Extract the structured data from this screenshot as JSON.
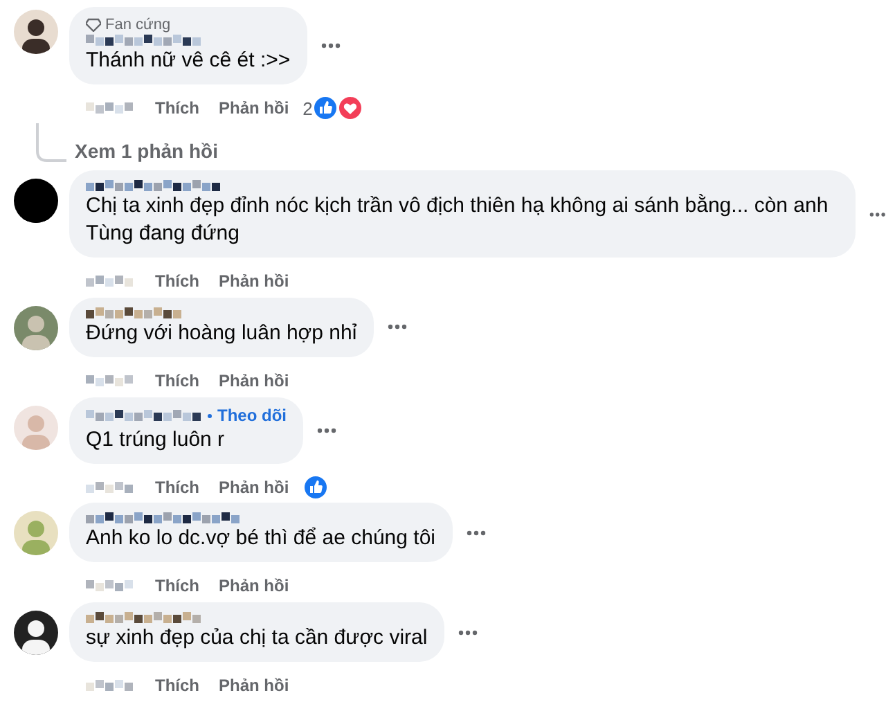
{
  "comments": [
    {
      "badge": "Fan cứng",
      "text": "Thánh nữ vê cê ét :>>",
      "actions": [
        "Thích",
        "Phản hồi"
      ],
      "reactions": {
        "count": "2",
        "like": true,
        "love": true
      },
      "replies_link": "Xem 1 phản hồi"
    },
    {
      "text": "Chị ta xinh đẹp đỉnh nóc kịch trần vô địch thiên hạ không ai sánh bằng... còn anh Tùng đang đứng",
      "actions": [
        "Thích",
        "Phản hồi"
      ]
    },
    {
      "text": "Đứng với hoàng luân hợp nhỉ",
      "actions": [
        "Thích",
        "Phản hồi"
      ]
    },
    {
      "follow": "Theo dõi",
      "text": "Q1 trúng luôn r",
      "actions": [
        "Thích",
        "Phản hồi"
      ],
      "reactions": {
        "like": true
      }
    },
    {
      "text": "Anh ko lo dc.vợ bé thì để ae chúng tôi",
      "actions": [
        "Thích",
        "Phản hồi"
      ]
    },
    {
      "text": "sự xinh đẹp của chị ta cần được viral",
      "actions": [
        "Thích",
        "Phản hồi"
      ]
    }
  ]
}
